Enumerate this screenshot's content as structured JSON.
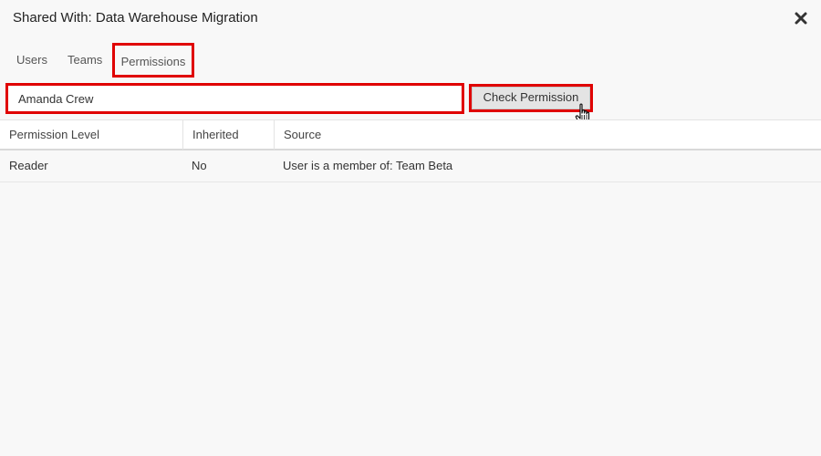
{
  "dialog": {
    "title": "Shared With: Data Warehouse Migration",
    "close_icon": "close-x-icon"
  },
  "tabs": [
    {
      "label": "Users",
      "active": false
    },
    {
      "label": "Teams",
      "active": false
    },
    {
      "label": "Permissions",
      "active": true
    }
  ],
  "search": {
    "value": "Amanda Crew",
    "placeholder": ""
  },
  "check_button": {
    "label": "Check Permission"
  },
  "table": {
    "columns": [
      "Permission Level",
      "Inherited",
      "Source"
    ],
    "rows": [
      [
        "Reader",
        "No",
        "User is a member of: Team Beta"
      ]
    ]
  },
  "colors": {
    "highlight": "#e00000",
    "background": "#f8f8f8",
    "button": "#e4e4e4"
  }
}
